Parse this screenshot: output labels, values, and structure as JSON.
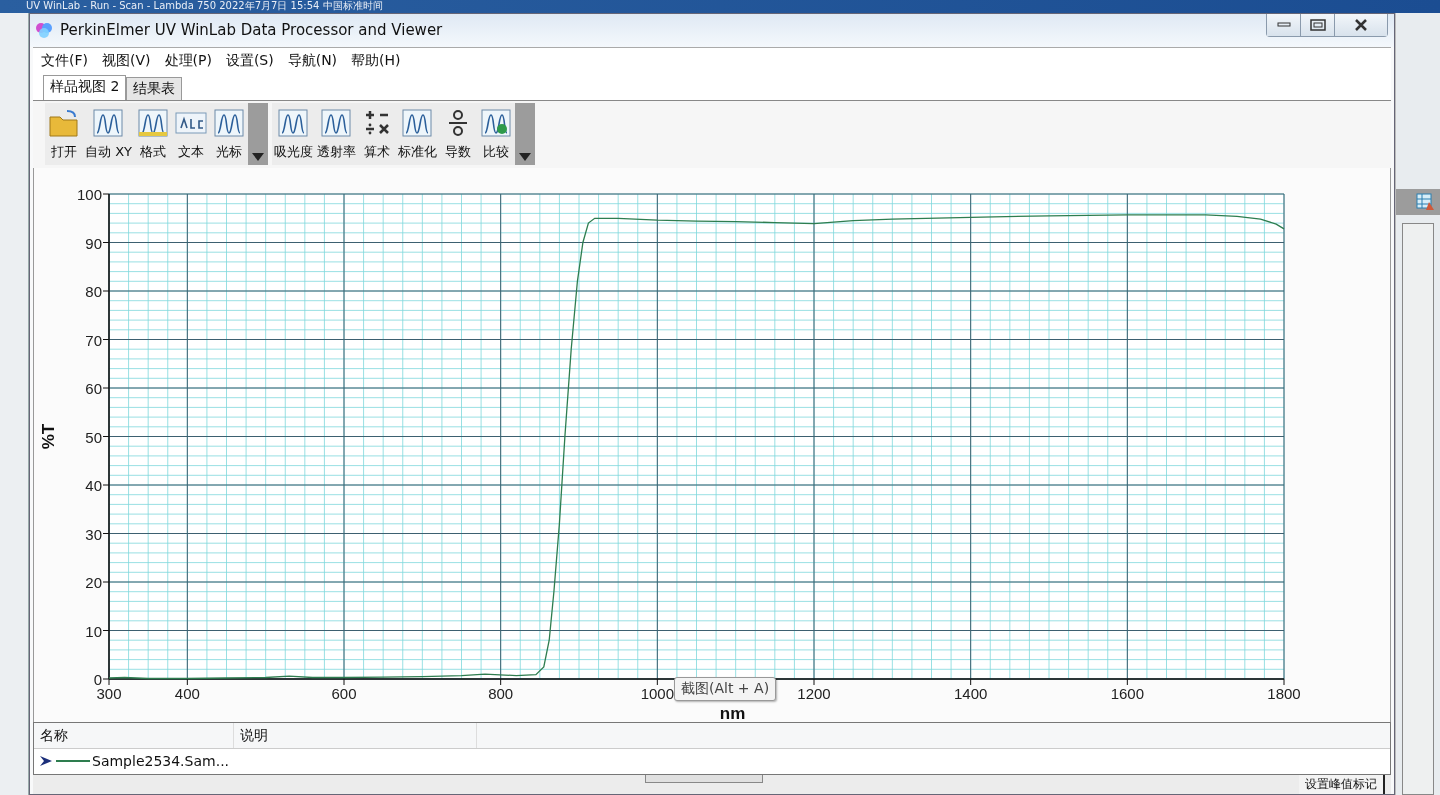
{
  "outer_window": {
    "title": "UV WinLab - Run - Scan - Lambda 750 2022年7月7日 15:54 中国标准时间"
  },
  "window": {
    "title": "PerkinElmer UV WinLab Data Processor and Viewer"
  },
  "menu": [
    "文件(F)",
    "视图(V)",
    "处理(P)",
    "设置(S)",
    "导航(N)",
    "帮助(H)"
  ],
  "tabs": [
    {
      "label": "样品视图 2",
      "selected": true
    },
    {
      "label": "结果表",
      "selected": false
    }
  ],
  "toolbar_groups": [
    {
      "items": [
        "打开",
        "自动 XY",
        "格式",
        "文本",
        "光标"
      ]
    },
    {
      "items": [
        "吸光度",
        "透射率",
        "算术",
        "标准化",
        "导数",
        "比较"
      ]
    }
  ],
  "chart": {
    "chart_data": {
      "type": "line",
      "xlabel": "nm",
      "ylabel": "%T",
      "xlim": [
        300,
        1800
      ],
      "ylim": [
        0,
        100
      ],
      "grid": true,
      "xticks": [
        300,
        400,
        600,
        800,
        1000,
        1200,
        1400,
        1600,
        1800
      ],
      "yticks": [
        0,
        10,
        20,
        30,
        40,
        50,
        60,
        70,
        80,
        90,
        100
      ],
      "x": [
        300,
        320,
        350,
        400,
        450,
        500,
        530,
        560,
        600,
        650,
        700,
        750,
        780,
        820,
        845,
        855,
        862,
        868,
        875,
        882,
        890,
        898,
        905,
        912,
        920,
        950,
        1000,
        1050,
        1100,
        1150,
        1200,
        1250,
        1300,
        1400,
        1500,
        1600,
        1700,
        1740,
        1770,
        1790,
        1800
      ],
      "series": [
        {
          "name": "Sample2534.Sam...",
          "color": "#2e7d4f",
          "values": [
            0.2,
            0.3,
            0.1,
            0.1,
            0.2,
            0.3,
            0.6,
            0.3,
            0.3,
            0.4,
            0.5,
            0.7,
            1.0,
            0.7,
            0.9,
            2.5,
            8,
            18,
            32,
            50,
            68,
            82,
            90,
            94,
            95,
            95,
            94.6,
            94.4,
            94.3,
            94.1,
            93.9,
            94.5,
            94.8,
            95.2,
            95.5,
            95.7,
            95.7,
            95.4,
            94.8,
            93.8,
            92.8
          ]
        }
      ]
    },
    "tooltip": "截图(Alt + A)"
  },
  "legend": {
    "columns": [
      "名称",
      "说明"
    ]
  },
  "bottom_button": "设置峰值标记"
}
